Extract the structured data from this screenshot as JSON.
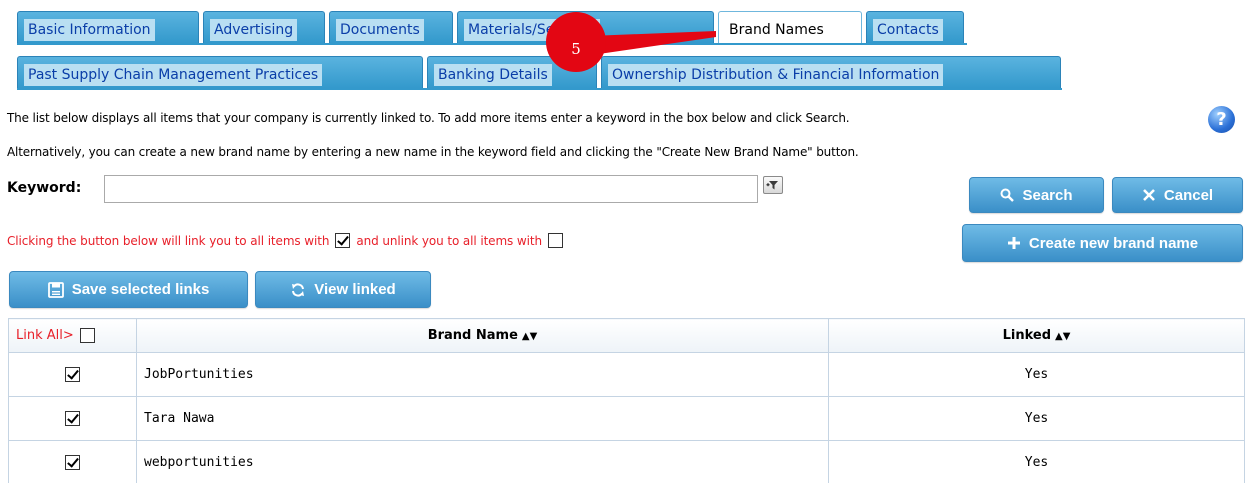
{
  "tabs_row1": [
    {
      "label": "Basic Information",
      "active": false
    },
    {
      "label": "Advertising",
      "active": false
    },
    {
      "label": "Documents",
      "active": false
    },
    {
      "label": "Materials/Services",
      "active": false
    },
    {
      "label": "Brand Names",
      "active": true
    },
    {
      "label": "Contacts",
      "active": false
    }
  ],
  "tabs_row2": [
    {
      "label": "Past Supply Chain Management Practices",
      "active": false
    },
    {
      "label": "Banking Details",
      "active": false
    },
    {
      "label": "Ownership Distribution & Financial Information",
      "active": false
    }
  ],
  "step_marker": "5",
  "info": {
    "line1": "The list below displays all items that your company is currently linked to. To add more items enter a keyword in the box below and click Search.",
    "line2": "Alternatively, you can create a new brand name by entering a new name in the keyword field and clicking the \"Create New Brand Name\" button."
  },
  "help_icon_glyph": "?",
  "keyword": {
    "label": "Keyword:",
    "value": "",
    "placeholder": ""
  },
  "buttons": {
    "search": "Search",
    "cancel": "Cancel",
    "create": "Create new brand name",
    "save": "Save selected links",
    "view": "View linked"
  },
  "instruction": {
    "part1": "Clicking the button below will link you to all items with",
    "part2": "and unlink you to all items with"
  },
  "table": {
    "link_all_label": "Link All>",
    "headers": {
      "brand": "Brand Name",
      "linked": "Linked"
    },
    "sort_glyph": "▲▼",
    "rows": [
      {
        "checked": true,
        "brand": "JobPortunities",
        "linked": "Yes"
      },
      {
        "checked": true,
        "brand": "Tara Nawa",
        "linked": "Yes"
      },
      {
        "checked": true,
        "brand": "webportunities",
        "linked": "Yes"
      }
    ]
  },
  "colors": {
    "tab_blue": "#3399cc",
    "tab_text": "#0a3ea8",
    "marker_red": "#e30613",
    "warning_red": "#e8202a",
    "button_blue": "#4a9fd4"
  }
}
